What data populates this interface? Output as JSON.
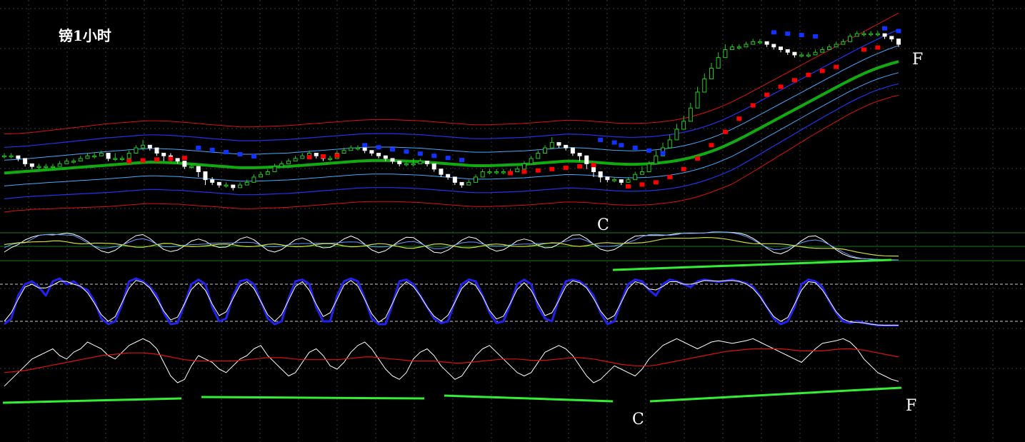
{
  "chart_data": {
    "type": "line",
    "title": "镑1小时",
    "annotations": {
      "c_price": "C",
      "f_price": "F",
      "c_indicator": "C",
      "f_indicator": "F"
    },
    "grid": true,
    "colors": {
      "background": "#000000",
      "grid": "#3a3a3a",
      "bull_candle": "#22cc22",
      "bear_candle": "#ffffff",
      "bollinger_outer": "#dd1111",
      "bollinger_mid": "#2233ee",
      "bollinger_inner": "#44aaff",
      "ma": "#11aa11",
      "sar_up": "#ff0000",
      "sar_down": "#1133ff",
      "trendline": "#33ee33",
      "stoch_main": "#2222ee",
      "stoch_signal": "#ffffff",
      "rsi": "#ffffff",
      "rsi_ma": "#dd1111"
    },
    "price_close": [
      300,
      300,
      299,
      297,
      296,
      296,
      296,
      296,
      297,
      298,
      298,
      299,
      300,
      300,
      301,
      299,
      299,
      299,
      301,
      303,
      304,
      303,
      301,
      300,
      299,
      298,
      296,
      296,
      294,
      291,
      290,
      289,
      289,
      288,
      289,
      290,
      292,
      293,
      294,
      296,
      297,
      298,
      299,
      300,
      301,
      300,
      299,
      299,
      301,
      302,
      303,
      303,
      302,
      301,
      300,
      299,
      298,
      297,
      297,
      297,
      298,
      297,
      295,
      293,
      292,
      290,
      289,
      290,
      292,
      294,
      294,
      294,
      294,
      294,
      295,
      297,
      299,
      301,
      303,
      305,
      304,
      303,
      301,
      300,
      297,
      294,
      292,
      291,
      291,
      290,
      291,
      293,
      294,
      297,
      300,
      303,
      306,
      310,
      313,
      318,
      324,
      329,
      333,
      337,
      340,
      341,
      341,
      342,
      343,
      343,
      342,
      341,
      340,
      339,
      338,
      338,
      338,
      339,
      340,
      341,
      342,
      343,
      345,
      346,
      346,
      346,
      346,
      345,
      344,
      342
    ],
    "price_high": [
      301,
      301,
      300,
      298,
      297,
      297,
      297,
      297,
      298,
      299,
      299,
      300,
      301,
      301,
      302,
      300,
      301,
      300,
      302,
      304,
      306,
      304,
      302,
      301,
      301,
      299,
      297,
      297,
      295,
      292,
      292,
      290,
      290,
      289,
      290,
      291,
      293,
      294,
      295,
      297,
      298,
      299,
      300,
      301,
      302,
      301,
      300,
      300,
      302,
      303,
      304,
      304,
      303,
      302,
      301,
      300,
      299,
      298,
      298,
      299,
      299,
      298,
      296,
      294,
      293,
      291,
      290,
      291,
      293,
      295,
      295,
      295,
      295,
      295,
      296,
      298,
      300,
      302,
      304,
      307,
      305,
      304,
      302,
      301,
      298,
      295,
      293,
      292,
      292,
      291,
      292,
      294,
      296,
      298,
      302,
      305,
      308,
      312,
      315,
      320,
      326,
      331,
      335,
      339,
      342,
      342,
      342,
      343,
      344,
      344,
      343,
      342,
      341,
      340,
      339,
      339,
      339,
      340,
      341,
      342,
      343,
      344,
      346,
      347,
      347,
      347,
      347,
      346,
      345,
      343
    ],
    "price_low": [
      299,
      299,
      298,
      296,
      295,
      295,
      295,
      295,
      296,
      297,
      297,
      298,
      299,
      299,
      300,
      298,
      298,
      298,
      300,
      302,
      302,
      302,
      300,
      298,
      298,
      297,
      295,
      295,
      292,
      289,
      289,
      288,
      288,
      287,
      288,
      289,
      291,
      292,
      293,
      295,
      296,
      297,
      298,
      299,
      300,
      299,
      298,
      298,
      300,
      301,
      302,
      302,
      301,
      300,
      299,
      298,
      297,
      296,
      296,
      296,
      297,
      296,
      294,
      292,
      291,
      289,
      288,
      289,
      291,
      293,
      293,
      293,
      293,
      293,
      294,
      296,
      298,
      300,
      302,
      303,
      303,
      302,
      300,
      298,
      295,
      292,
      290,
      290,
      290,
      289,
      290,
      292,
      293,
      295,
      298,
      301,
      304,
      308,
      311,
      316,
      321,
      326,
      331,
      335,
      339,
      340,
      340,
      341,
      342,
      342,
      341,
      340,
      339,
      338,
      337,
      337,
      337,
      338,
      339,
      340,
      341,
      342,
      344,
      345,
      345,
      345,
      345,
      344,
      343,
      341
    ],
    "ma": [
      293.5,
      293.7,
      293.9,
      294.1,
      294.3,
      294.5,
      294.7,
      294.9,
      295.1,
      295.3,
      295.5,
      295.7,
      295.9,
      296.1,
      296.3,
      296.5,
      296.7,
      296.9,
      297.1,
      297.3,
      297.5,
      297.6,
      297.6,
      297.5,
      297.4,
      297.3,
      297.1,
      296.9,
      296.7,
      296.5,
      296.3,
      296.1,
      295.9,
      295.7,
      295.5,
      295.5,
      295.5,
      295.6,
      295.7,
      295.8,
      295.9,
      296.0,
      296.2,
      296.4,
      296.6,
      296.8,
      297.0,
      297.2,
      297.4,
      297.6,
      297.8,
      298.0,
      298.1,
      298.2,
      298.2,
      298.2,
      298.2,
      298.1,
      298.0,
      297.9,
      297.8,
      297.6,
      297.4,
      297.2,
      297.0,
      296.8,
      296.6,
      296.4,
      296.3,
      296.3,
      296.3,
      296.4,
      296.5,
      296.6,
      296.7,
      296.8,
      297.0,
      297.2,
      297.4,
      297.6,
      297.8,
      298.0,
      298.0,
      297.9,
      297.8,
      297.6,
      297.4,
      297.2,
      297.0,
      296.9,
      296.8,
      296.8,
      296.9,
      297.0,
      297.2,
      297.5,
      297.8,
      298.2,
      298.7,
      299.3,
      300.0,
      300.8,
      301.7,
      302.7,
      303.8,
      305.0,
      306.3,
      307.6,
      309.0,
      310.4,
      311.8,
      313.2,
      314.6,
      316.0,
      317.4,
      318.8,
      320.2,
      321.6,
      323.0,
      324.4,
      325.8,
      327.2,
      328.5,
      329.8,
      331.0,
      332.1,
      333.1,
      334.0,
      334.8,
      335.5
    ],
    "bands": {
      "outer_upper": [
        308.2,
        308.3,
        308.4,
        308.6,
        308.8,
        309.1,
        309.4,
        309.7,
        310.0,
        310.3,
        310.6,
        310.9,
        311.2,
        311.5,
        311.8,
        312.1,
        312.3,
        312.5,
        312.7,
        312.9,
        313.1,
        313.2,
        313.2,
        313.1,
        313.0,
        312.8,
        312.6,
        312.4,
        312.2,
        311.9,
        311.7,
        311.5,
        311.3,
        311.1,
        310.9,
        310.9,
        310.9,
        311.0,
        311.1,
        311.2,
        311.3,
        311.4,
        311.6,
        311.8,
        312.0,
        312.2,
        312.4,
        312.6,
        312.8,
        313.0,
        313.2,
        313.4,
        313.5,
        313.6,
        313.6,
        313.6,
        313.6,
        313.5,
        313.4,
        313.3,
        313.2,
        313.0,
        312.8,
        312.6,
        312.4,
        312.2,
        312.0,
        311.8,
        311.7,
        311.7,
        311.7,
        311.8,
        311.9,
        312.0,
        312.1,
        312.2,
        312.4,
        312.6,
        312.8,
        313.0,
        313.2,
        313.4,
        313.4,
        313.3,
        313.2,
        313.0,
        312.8,
        312.6,
        312.4,
        312.3,
        312.2,
        312.2,
        312.3,
        312.4,
        312.6,
        312.9,
        313.2,
        313.6,
        314.1,
        314.7,
        315.4,
        316.2,
        317.1,
        318.1,
        319.2,
        320.4,
        321.7,
        323.0,
        324.4,
        325.8,
        327.2,
        328.6,
        330.0,
        331.4,
        332.8,
        334.2,
        335.6,
        337.0,
        338.4,
        339.8,
        341.2,
        342.6,
        344.0,
        345.4,
        346.8,
        348.2,
        349.6,
        351.0,
        352.4,
        353.8
      ],
      "outer_lower": [
        278.8,
        279.1,
        279.4,
        279.6,
        279.8,
        279.9,
        280.0,
        280.1,
        280.2,
        280.3,
        280.4,
        280.5,
        280.6,
        280.7,
        280.8,
        280.9,
        281.1,
        281.3,
        281.5,
        281.7,
        281.9,
        282.0,
        282.0,
        281.9,
        281.8,
        281.8,
        281.6,
        281.4,
        281.2,
        281.1,
        280.9,
        280.7,
        280.5,
        280.3,
        280.1,
        280.1,
        280.1,
        280.2,
        280.3,
        280.4,
        280.5,
        280.6,
        280.8,
        281.0,
        281.2,
        281.4,
        281.6,
        281.8,
        282.0,
        282.2,
        282.4,
        282.6,
        282.7,
        282.8,
        282.8,
        282.8,
        282.8,
        282.7,
        282.6,
        282.5,
        282.4,
        282.2,
        282.0,
        281.8,
        281.6,
        281.4,
        281.2,
        281.0,
        280.9,
        280.9,
        280.9,
        281.0,
        281.1,
        281.2,
        281.3,
        281.4,
        281.6,
        281.8,
        282.0,
        282.2,
        282.4,
        282.6,
        282.6,
        282.5,
        282.4,
        282.2,
        282.0,
        281.8,
        281.6,
        281.5,
        281.4,
        281.4,
        281.5,
        281.6,
        281.8,
        282.1,
        282.4,
        282.8,
        283.3,
        283.9,
        284.6,
        285.4,
        286.3,
        287.3,
        288.3,
        289.4,
        290.9,
        292.4,
        294.0,
        295.6,
        297.2,
        298.8,
        300.4,
        302.0,
        303.6,
        305.2,
        306.8,
        308.4,
        309.9,
        311.4,
        312.9,
        314.4,
        315.9,
        317.2,
        318.4,
        319.6,
        320.6,
        321.4,
        322.2,
        322.8
      ]
    },
    "sar": {
      "up": [
        [
          18,
          298
        ],
        [
          20,
          298.3
        ],
        [
          22,
          298.6
        ],
        [
          24,
          298.9
        ],
        [
          26,
          299.2
        ],
        [
          44,
          299.5
        ],
        [
          46,
          299.8
        ],
        [
          48,
          300.1
        ],
        [
          73,
          293.5
        ],
        [
          75,
          294.0
        ],
        [
          77,
          294.5
        ],
        [
          79,
          295.0
        ],
        [
          81,
          295.5
        ],
        [
          83,
          296.0
        ],
        [
          85,
          296.5
        ],
        [
          90,
          288.5
        ],
        [
          92,
          289.2
        ],
        [
          94,
          290.0
        ],
        [
          96,
          292.0
        ],
        [
          98,
          295.0
        ],
        [
          100,
          299.0
        ],
        [
          102,
          304.0
        ],
        [
          104,
          309.0
        ],
        [
          106,
          314.0
        ],
        [
          108,
          319.0
        ],
        [
          110,
          323.0
        ],
        [
          112,
          326.0
        ],
        [
          114,
          328.5
        ],
        [
          116,
          330.5
        ],
        [
          118,
          332.0
        ],
        [
          120,
          333.5
        ],
        [
          124,
          340.0
        ],
        [
          126,
          340.8
        ]
      ],
      "down": [
        [
          28,
          303.0
        ],
        [
          30,
          302.2
        ],
        [
          32,
          301.4
        ],
        [
          34,
          300.6
        ],
        [
          36,
          299.8
        ],
        [
          52,
          304.0
        ],
        [
          54,
          303.2
        ],
        [
          56,
          302.4
        ],
        [
          58,
          301.6
        ],
        [
          60,
          300.8
        ],
        [
          62,
          300.0
        ],
        [
          64,
          299.2
        ],
        [
          66,
          298.4
        ],
        [
          86,
          306.0
        ],
        [
          88,
          305.0
        ],
        [
          89,
          304.0
        ],
        [
          91,
          303.0
        ],
        [
          93,
          302.0
        ],
        [
          95,
          301.0
        ],
        [
          111,
          346.5
        ],
        [
          113,
          346.0
        ],
        [
          115,
          345.5
        ],
        [
          117,
          345.0
        ],
        [
          127,
          348.0
        ],
        [
          129,
          347.0
        ]
      ]
    },
    "stoch_main": [
      10,
      20,
      60,
      80,
      85,
      75,
      60,
      85,
      90,
      80,
      85,
      75,
      70,
      50,
      20,
      10,
      15,
      45,
      85,
      90,
      85,
      75,
      60,
      30,
      10,
      12,
      45,
      80,
      88,
      80,
      40,
      15,
      20,
      60,
      85,
      88,
      80,
      50,
      20,
      10,
      15,
      55,
      85,
      88,
      80,
      40,
      15,
      15,
      60,
      85,
      90,
      85,
      55,
      20,
      10,
      10,
      45,
      85,
      88,
      80,
      60,
      40,
      20,
      12,
      15,
      50,
      80,
      88,
      85,
      60,
      30,
      12,
      15,
      45,
      80,
      88,
      80,
      40,
      20,
      15,
      55,
      85,
      88,
      85,
      75,
      60,
      30,
      10,
      15,
      50,
      80,
      88,
      85,
      70,
      60,
      80,
      88,
      85,
      80,
      75,
      85,
      88,
      86,
      84,
      86,
      88,
      85,
      82,
      75,
      60,
      40,
      20,
      10,
      15,
      40,
      80,
      88,
      85,
      75,
      50,
      30,
      15,
      12,
      15,
      12,
      10,
      8,
      8,
      8,
      8
    ],
    "rsi": [
      15,
      25,
      35,
      45,
      55,
      60,
      65,
      70,
      60,
      55,
      65,
      70,
      80,
      75,
      70,
      60,
      55,
      65,
      75,
      80,
      85,
      80,
      70,
      50,
      30,
      20,
      25,
      45,
      60,
      55,
      50,
      40,
      35,
      45,
      55,
      60,
      70,
      75,
      60,
      50,
      40,
      30,
      35,
      50,
      65,
      70,
      60,
      45,
      40,
      50,
      65,
      75,
      80,
      70,
      55,
      40,
      30,
      25,
      35,
      55,
      65,
      70,
      60,
      45,
      35,
      25,
      30,
      45,
      60,
      70,
      75,
      65,
      55,
      45,
      35,
      30,
      35,
      50,
      65,
      70,
      75,
      70,
      60,
      45,
      30,
      20,
      25,
      35,
      45,
      40,
      35,
      30,
      40,
      55,
      65,
      75,
      80,
      85,
      80,
      75,
      70,
      75,
      80,
      82,
      80,
      78,
      80,
      82,
      85,
      80,
      75,
      70,
      65,
      60,
      55,
      50,
      60,
      70,
      78,
      80,
      82,
      85,
      80,
      70,
      55,
      45,
      35,
      30,
      25,
      22
    ],
    "rsi_ma": [
      35,
      36,
      37,
      38,
      40,
      42,
      44,
      46,
      48,
      50,
      52,
      54,
      56,
      58,
      60,
      61,
      62,
      63,
      64,
      64,
      64,
      63,
      62,
      60,
      58,
      56,
      54,
      53,
      52,
      52,
      52,
      52,
      52,
      52,
      53,
      54,
      55,
      56,
      57,
      57,
      57,
      56,
      55,
      54,
      54,
      54,
      54,
      54,
      54,
      55,
      56,
      57,
      58,
      58,
      57,
      56,
      55,
      54,
      53,
      52,
      52,
      52,
      52,
      51,
      50,
      49,
      49,
      50,
      51,
      52,
      53,
      54,
      55,
      55,
      55,
      54,
      53,
      53,
      53,
      54,
      55,
      56,
      57,
      57,
      56,
      55,
      53,
      51,
      49,
      47,
      46,
      45,
      45,
      45,
      46,
      48,
      50,
      52,
      54,
      56,
      58,
      60,
      62,
      64,
      66,
      67,
      68,
      69,
      70,
      70,
      70,
      70,
      70,
      69,
      68,
      67,
      67,
      67,
      67,
      68,
      69,
      70,
      70,
      69,
      68,
      66,
      64,
      62,
      60,
      58
    ]
  }
}
